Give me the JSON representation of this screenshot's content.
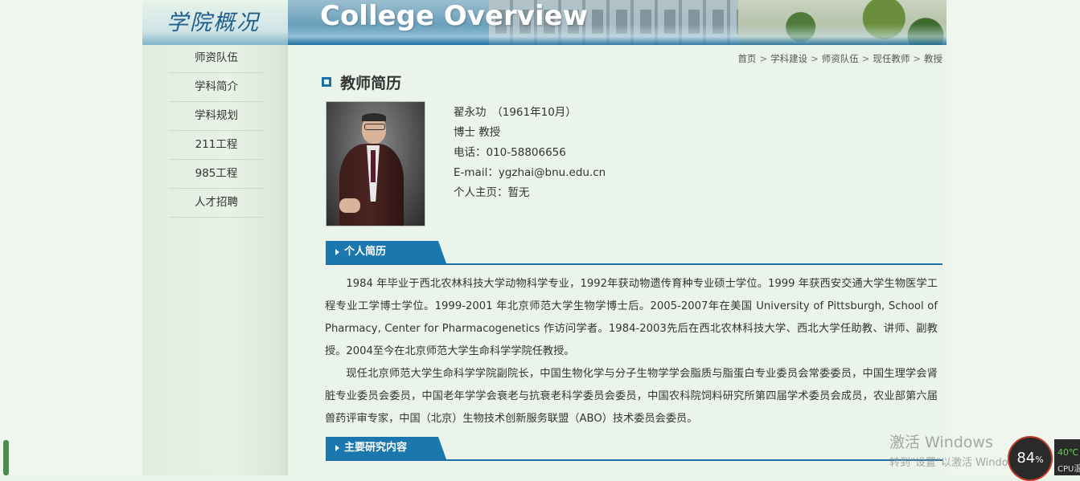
{
  "sidebar": {
    "title": "学院概况",
    "items": [
      {
        "label": "师资队伍"
      },
      {
        "label": "学科简介"
      },
      {
        "label": "学科规划"
      },
      {
        "label": "211工程"
      },
      {
        "label": "985工程"
      },
      {
        "label": "人才招聘"
      }
    ]
  },
  "banner": {
    "title": "College Overview"
  },
  "breadcrumb": {
    "items": [
      "首页",
      "学科建设",
      "师资队伍",
      "现任教师",
      "教授"
    ],
    "separator": ">"
  },
  "page": {
    "title": "教师简历"
  },
  "profile": {
    "name_line": "翟永功　（1961年10月）",
    "degree_line": "博士 教授",
    "phone_line": "电话：010-58806656",
    "email_line": "E-mail：ygzhai@bnu.edu.cn",
    "homepage_line": "个人主页：暂无"
  },
  "sections": {
    "bio_title": "个人简历",
    "research_title": "主要研究内容"
  },
  "bio": {
    "p1": "1984 年毕业于西北农林科技大学动物科学专业，1992年获动物遗传育种专业硕士学位。1999 年获西安交通大学生物医学工程专业工学博士学位。1999-2001 年北京师范大学生物学博士后。2005-2007年在美国 University of Pittsburgh, School of Pharmacy, Center for Pharmacogenetics 作访问学者。1984-2003先后在西北农林科技大学、西北大学任助教、讲师、副教授。2004至今在北京师范大学生命科学学院任教授。",
    "p2": "现任北京师范大学生命科学学院副院长，中国生物化学与分子生物学学会脂质与脂蛋白专业委员会常委委员，中国生理学会肾脏专业委员会委员，中国老年学学会衰老与抗衰老科学委员会委员，中国农科院饲料研究所第四届学术委员会成员，农业部第六届兽药评审专家，中国（北京）生物技术创新服务联盟（ABO）技术委员会委员。"
  },
  "overlay": {
    "watermark_line1": "激活 Windows",
    "watermark_line2": "转到\"设置\"以激活 Windows。",
    "perf_value": "84",
    "perf_unit": "%",
    "perf_temp": "40℃",
    "perf_label": "CPU温度"
  }
}
